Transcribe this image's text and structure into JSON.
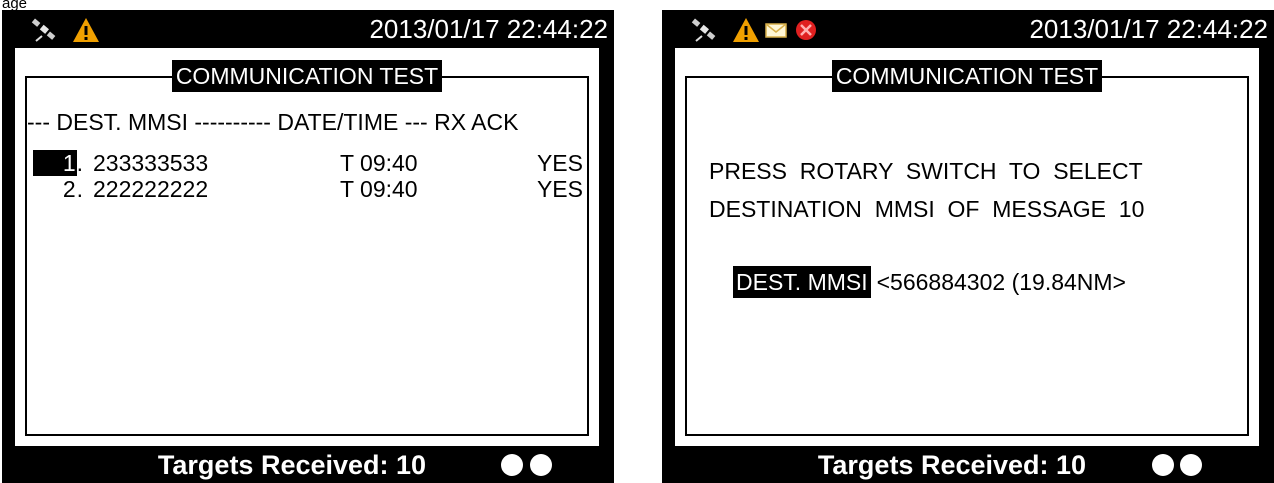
{
  "caption": "age",
  "colors": {
    "screen_bg": "#000000",
    "panel_bg": "#ffffff",
    "warning_amber": "#f0a000",
    "alarm_red": "#e02020",
    "led_white": "#ffffff"
  },
  "left_screen": {
    "status": {
      "icons": [
        "satellite-icon",
        "warning-icon"
      ],
      "datetime": "2013/01/17 22:44:22"
    },
    "title": "COMMUNICATION TEST",
    "header": "--- DEST. MMSI ---------- DATE/TIME --- RX ACK",
    "rows": [
      {
        "index": "1",
        "sep": ".",
        "mmsi": "233333533",
        "datetime": "T 09:40",
        "ack": "YES",
        "selected": true
      },
      {
        "index": "2",
        "sep": ".",
        "mmsi": "222222222",
        "datetime": "T 09:40",
        "ack": "YES",
        "selected": false
      }
    ],
    "footer": {
      "text": "Targets Received: 10",
      "leds": 2
    }
  },
  "right_screen": {
    "status": {
      "icons": [
        "satellite-icon",
        "warning-icon",
        "envelope-icon",
        "alarm-icon"
      ],
      "datetime": "2013/01/17 22:44:22"
    },
    "title": "COMMUNICATION TEST",
    "message_line1": "PRESS  ROTARY  SWITCH  TO  SELECT",
    "message_line2": "DESTINATION  MMSI  OF  MESSAGE  10",
    "dest_label": "DEST. MMSI",
    "dest_value": "<566884302 (19.84NM>",
    "footer": {
      "text": "Targets Received: 10",
      "leds": 2
    }
  }
}
